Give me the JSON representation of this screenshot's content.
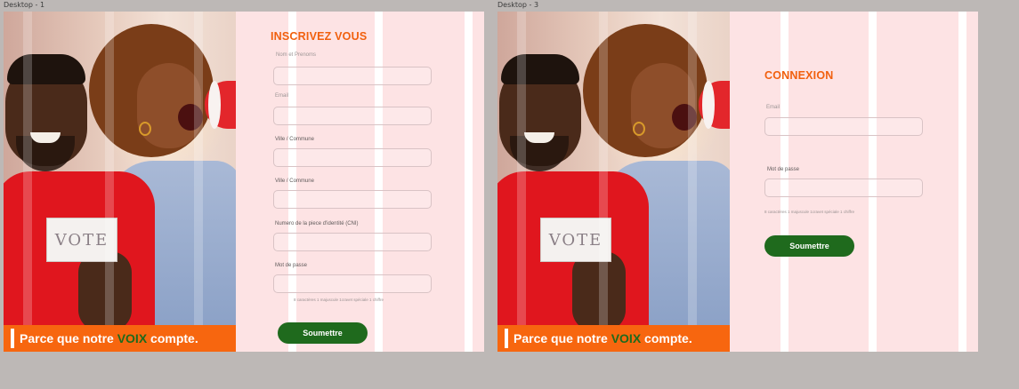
{
  "frames": {
    "frame1": {
      "label": "Desktop - 1"
    },
    "frame3": {
      "label": "Desktop - 3"
    }
  },
  "photo": {
    "vote_card": "VOTE"
  },
  "banner": {
    "text_before": "Parce que notre ",
    "text_voix": "VOIX",
    "text_after": " compte."
  },
  "signup": {
    "title": "INSCRIVEZ VOUS",
    "fields": [
      {
        "label": "Nom et Prenoms",
        "value": ""
      },
      {
        "label": "Email",
        "value": ""
      },
      {
        "label": "Ville / Commune",
        "value": ""
      },
      {
        "label": "Ville / Commune",
        "value": ""
      },
      {
        "label": "Numero de la piece d'identité (CNI)",
        "value": ""
      },
      {
        "label": "Mot de passe",
        "value": ""
      }
    ],
    "password_hint": "8 caractères 1 majuscule 1cravet spéciale 1 chiffre",
    "submit_label": "Soumettre"
  },
  "login": {
    "title": "CONNEXION",
    "fields": [
      {
        "label": "Email",
        "value": ""
      },
      {
        "label": "Mot de passe",
        "value": ""
      }
    ],
    "password_hint": "8 caractères 1 majuscule 1cravet spéciale 1 chiffre",
    "submit_label": "Soumettre"
  },
  "colors": {
    "canvas": "#bdb8b6",
    "accent_orange": "#f1600e",
    "banner_orange": "#f7660f",
    "button_green": "#1f6a1d",
    "panel_pink": "#fde3e4"
  }
}
